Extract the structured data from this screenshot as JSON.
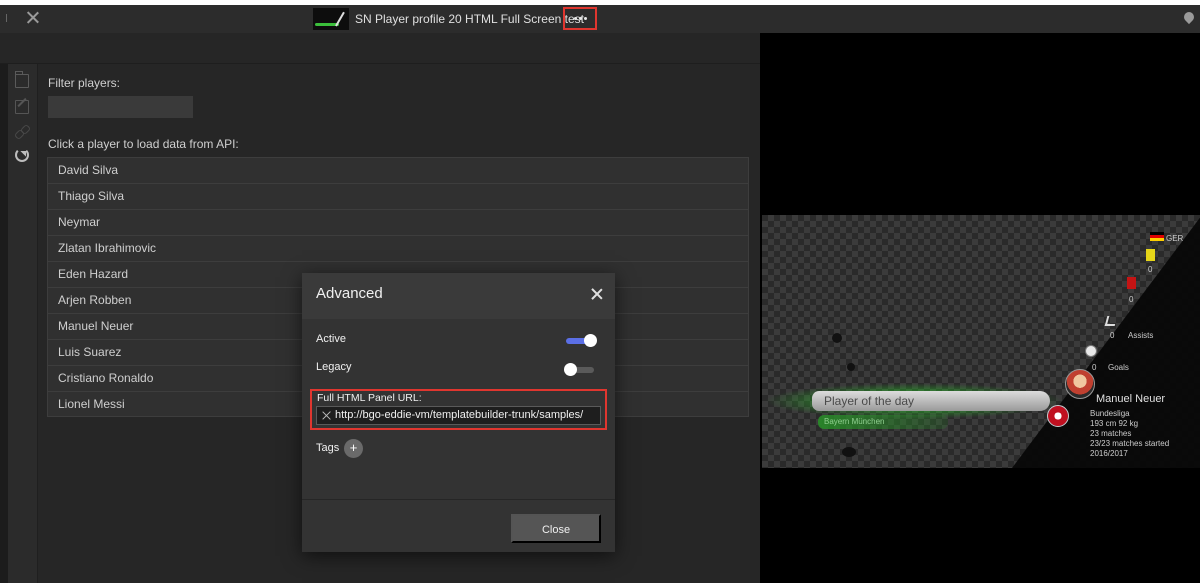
{
  "titlebar": {
    "title": "SN Player profile 20 HTML Full Screen test",
    "more_label": "•••"
  },
  "left_panel": {
    "filter_label": "Filter players:",
    "filter_value": "",
    "list_label": "Click a player to load data from API:",
    "players": [
      "David Silva",
      "Thiago Silva",
      "Neymar",
      "Zlatan Ibrahimovic",
      "Eden Hazard",
      "Arjen Robben",
      "Manuel Neuer",
      "Luis Suarez",
      "Cristiano Ronaldo",
      "Lionel Messi"
    ]
  },
  "preview": {
    "banner_title": "Player of the day",
    "banner_team": "Bayern München",
    "nationality": "GER",
    "yellow_cards": "0",
    "red_cards": "0",
    "assists_value": "0",
    "assists_label": "Assists",
    "goals_value": "0",
    "goals_label": "Goals",
    "player_name": "Manuel Neuer",
    "league": "Bundesliga",
    "height_weight": "193 cm 92 kg",
    "matches": "23 matches",
    "matches_started": "23/23 matches started",
    "season": "2016/2017",
    "colors": {
      "glow": "#3bd43b",
      "toggle_on": "#5b6fe6",
      "highlight": "#e0362f"
    }
  },
  "modal": {
    "title": "Advanced",
    "active_label": "Active",
    "active_on": true,
    "legacy_label": "Legacy",
    "legacy_on": false,
    "url_label": "Full HTML Panel URL:",
    "url_value": "http://bgo-eddie-vm/templatebuilder-trunk/samples/",
    "tags_label": "Tags",
    "tags_add": "+",
    "close_label": "Close"
  },
  "icons": [
    "close-icon",
    "more-icon",
    "pin-icon",
    "folder-icon",
    "edit-icon",
    "link-icon",
    "refresh-icon",
    "clear-icon",
    "add-icon"
  ]
}
